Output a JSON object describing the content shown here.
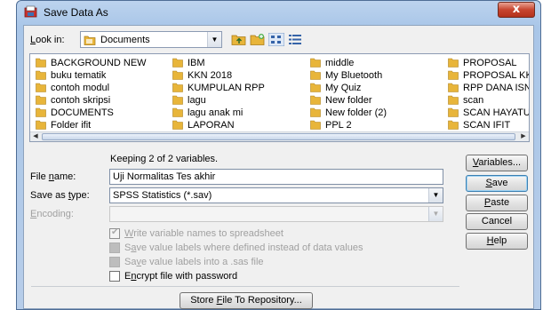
{
  "window": {
    "title": "Save Data As",
    "close_glyph": "x"
  },
  "lookin": {
    "label": "Look in:",
    "value": "Documents"
  },
  "files": [
    "BACKGROUND NEW",
    "buku tematik",
    "contoh modul",
    "contoh skripsi",
    "DOCUMENTS",
    "Folder ifit",
    "IBM",
    "KKN 2018",
    "KUMPULAN RPP",
    "lagu",
    "lagu anak mi",
    "LAPORAN",
    "middle",
    "My Bluetooth",
    "My Quiz",
    "New folder",
    "New folder (2)",
    "PPL 2",
    "PROPOSAL",
    "PROPOSAL KK",
    "RPP DANA ISN",
    "scan",
    "SCAN HAYATU",
    "SCAN IFIT"
  ],
  "status": {
    "keeping_text": "Keeping 2 of 2 variables."
  },
  "filename": {
    "label": "File name:",
    "value": "Uji Normalitas Tes akhir"
  },
  "saveas": {
    "label": "Save as type:",
    "value": "SPSS Statistics (*.sav)"
  },
  "encoding": {
    "label": "Encoding:",
    "value": ""
  },
  "options": {
    "write_names": "Write variable names to spreadsheet",
    "save_value_labels": "Save value labels where defined instead of data values",
    "save_sas": "Save value labels into a .sas file",
    "encrypt": "Encrypt file with password"
  },
  "buttons": {
    "variables": "Variables...",
    "save": "Save",
    "paste": "Paste",
    "cancel": "Cancel",
    "help": "Help",
    "store": "Store File To Repository..."
  },
  "icons": {
    "title": "save-data-icon",
    "folder": "folder-icon",
    "up_folder": "up-folder-icon",
    "new_folder": "new-folder-icon",
    "list_view": "list-view-icon",
    "details_view": "details-view-icon"
  },
  "colors": {
    "folder": "#e8b53a",
    "title_gradient_top": "#bcd3ee",
    "close": "#c7452f"
  }
}
